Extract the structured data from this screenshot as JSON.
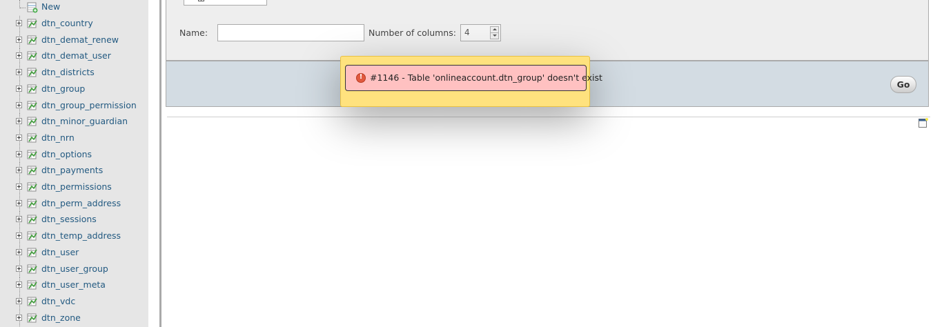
{
  "navigation": {
    "new_item": {
      "label": "New",
      "icon": "new-table-icon"
    },
    "tables": [
      {
        "label": "dtn_country"
      },
      {
        "label": "dtn_demat_renew"
      },
      {
        "label": "dtn_demat_user"
      },
      {
        "label": "dtn_districts"
      },
      {
        "label": "dtn_group"
      },
      {
        "label": "dtn_group_permission"
      },
      {
        "label": "dtn_minor_guardian"
      },
      {
        "label": "dtn_nrn"
      },
      {
        "label": "dtn_options"
      },
      {
        "label": "dtn_payments"
      },
      {
        "label": "dtn_permissions"
      },
      {
        "label": "dtn_perm_address"
      },
      {
        "label": "dtn_sessions"
      },
      {
        "label": "dtn_temp_address"
      },
      {
        "label": "dtn_user"
      },
      {
        "label": "dtn_user_group"
      },
      {
        "label": "dtn_user_meta"
      },
      {
        "label": "dtn_vdc"
      },
      {
        "label": "dtn_zone"
      }
    ]
  },
  "create_table": {
    "name_label": "Name:",
    "name_value": "",
    "columns_label": "Number of columns:",
    "columns_value": "4",
    "go_label": "Go"
  },
  "error": {
    "message": "#1146 - Table 'onlineaccount.dtn_group' doesn't exist",
    "icon": "error-icon"
  },
  "colors": {
    "nav_background": "#e6e6e6",
    "link": "#235a81",
    "toolbar": "#d3dce3",
    "popup_background": "#ffe27e",
    "error_background": "#ffc1c1"
  }
}
